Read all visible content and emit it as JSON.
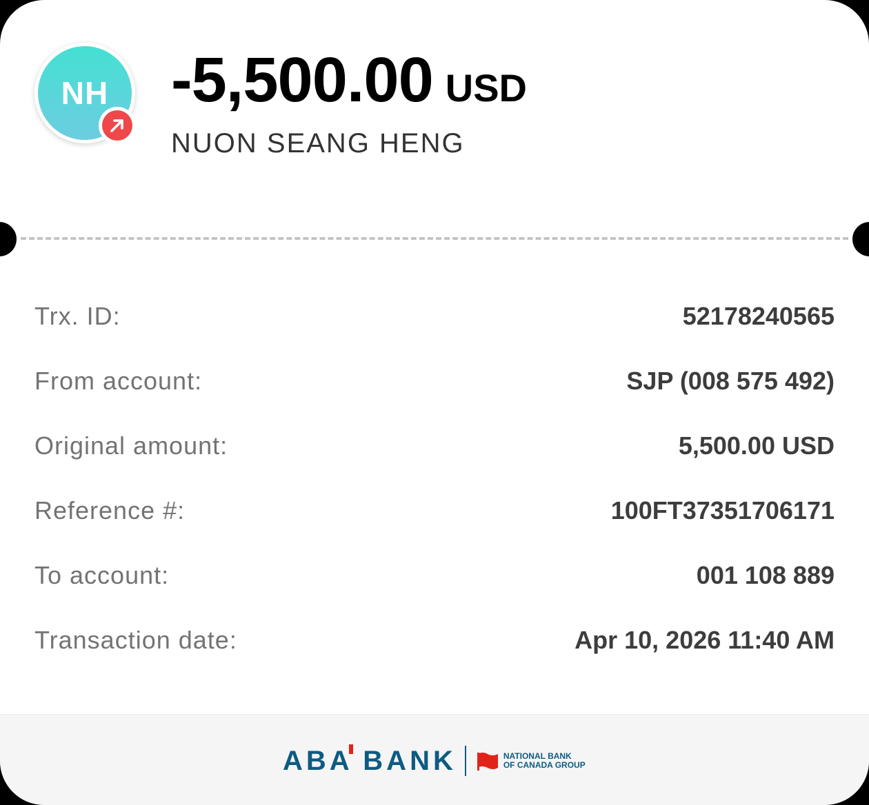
{
  "header": {
    "avatar_initials": "NH",
    "avatar_gradient": [
      "#45e0d3",
      "#6ccde0"
    ],
    "badge_icon": "arrow-up-right-icon",
    "badge_color": "#f0474b",
    "amount": "-5,500.00",
    "currency": "USD",
    "recipient_name": "NUON SEANG HENG"
  },
  "details": {
    "rows": [
      {
        "label": "Trx. ID:",
        "value": "52178240565"
      },
      {
        "label": "From account:",
        "value": "SJP (008 575 492)"
      },
      {
        "label": "Original amount:",
        "value": "5,500.00 USD"
      },
      {
        "label": "Reference #:",
        "value": "100FT37351706171"
      },
      {
        "label": "To account:",
        "value": "001 108 889"
      },
      {
        "label": "Transaction date:",
        "value": "Apr 10, 2026 11:40 AM"
      }
    ]
  },
  "footer": {
    "bank_name": "ABA BANK",
    "group_line1": "NATIONAL BANK",
    "group_line2": "OF CANADA GROUP",
    "brand_color": "#0d5b82",
    "accent_color": "#e2231a"
  }
}
